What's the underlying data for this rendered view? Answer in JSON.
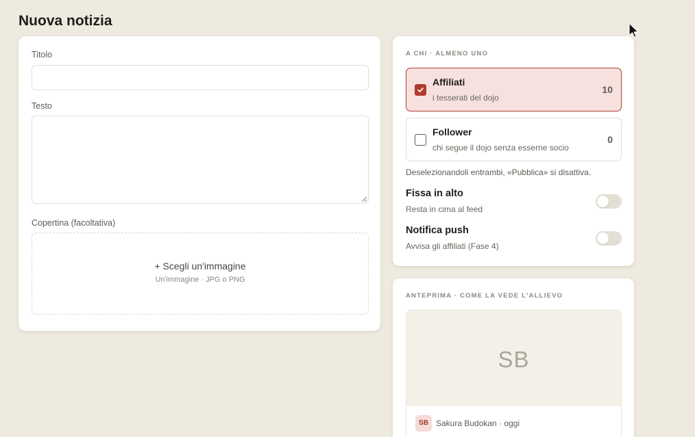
{
  "page": {
    "title": "Nuova notizia"
  },
  "form": {
    "title_label": "Titolo",
    "title_value": "",
    "text_label": "Testo",
    "text_value": "",
    "cover_label": "Copertina (facoltativa)",
    "cover_action": "+ Scegli un'immagine",
    "cover_hint": "Un'immagine · JPG o PNG"
  },
  "audience": {
    "heading": "A CHI · ALMENO UNO",
    "options": [
      {
        "title": "Affiliati",
        "subtitle": "i tesserati del dojo",
        "count": "10",
        "checked": true
      },
      {
        "title": "Follower",
        "subtitle": "chi segue il dojo senza esserne socio",
        "count": "0",
        "checked": false
      }
    ],
    "hint": "Deselezionandoli entrambi, «Pubblica» si disattiva.",
    "toggles": [
      {
        "title": "Fissa in alto",
        "subtitle": "Resta in cima al feed",
        "on": false
      },
      {
        "title": "Notifica push",
        "subtitle": "Avvisa gli affiliati (Fase 4)",
        "on": false
      }
    ]
  },
  "preview": {
    "heading": "ANTEPRIMA · COME LA VEDE L'ALLIEVO",
    "cover_initials": "SB",
    "avatar_initials": "SB",
    "meta": "Sakura Budokan · oggi"
  },
  "colors": {
    "background": "#efeae0",
    "accent": "#b23a2e",
    "selected_bg": "#f7e1de"
  },
  "icons": {
    "check": "check-icon",
    "cursor": "mouse-cursor-icon"
  }
}
